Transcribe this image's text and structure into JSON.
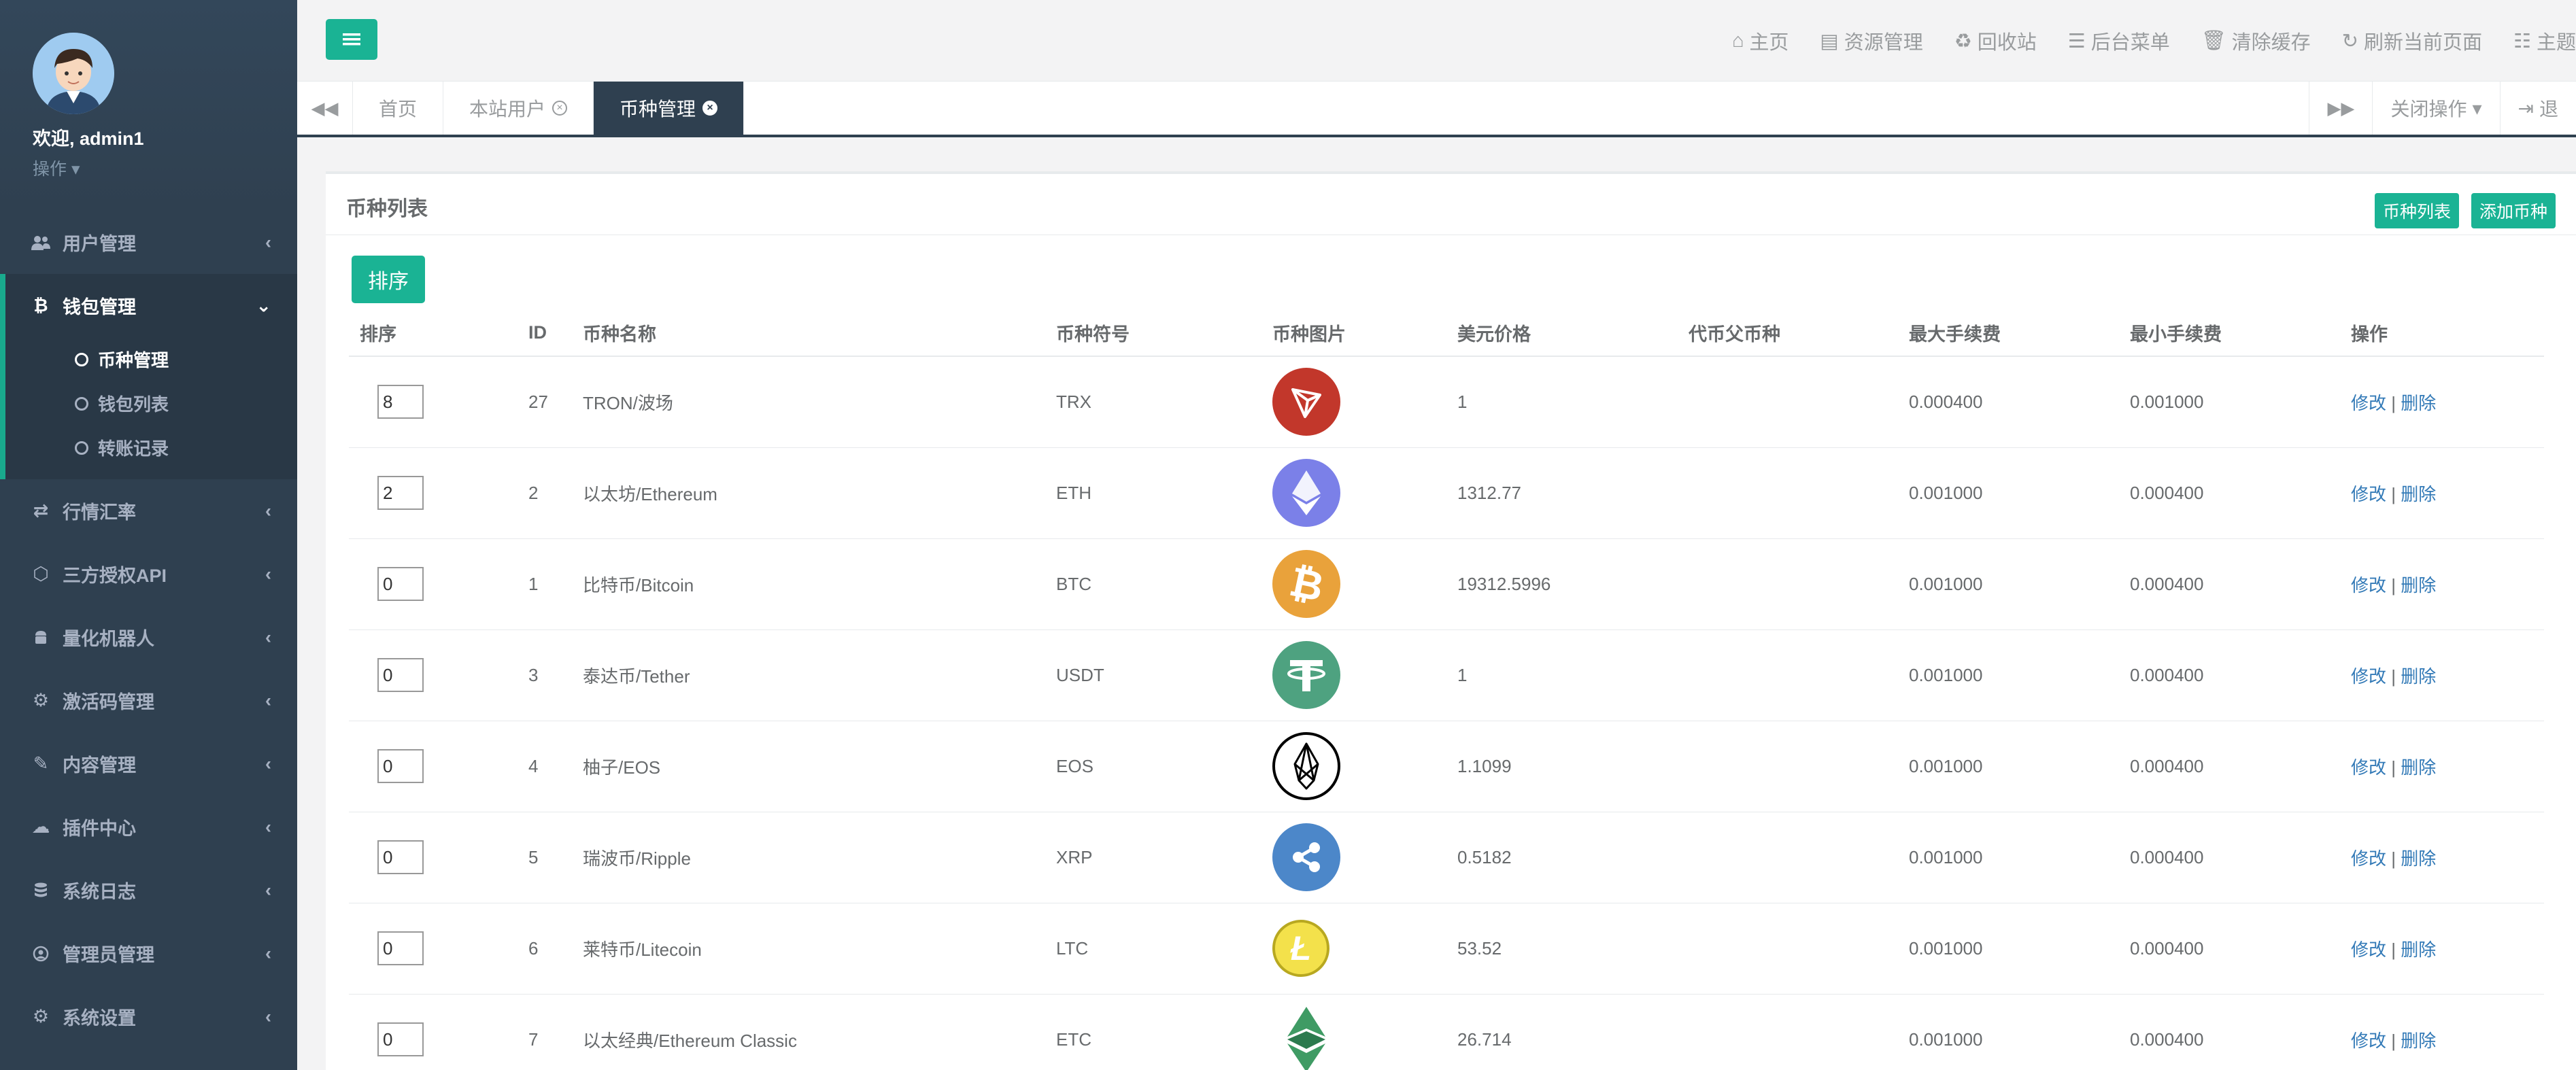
{
  "profile": {
    "welcome": "欢迎, admin1",
    "op_label": "操作"
  },
  "sidebar": {
    "items": [
      {
        "label": "用户管理",
        "icon": "users-icon"
      },
      {
        "label": "钱包管理",
        "icon": "bitcoin-icon",
        "expanded": true,
        "children": [
          {
            "label": "币种管理",
            "current": true
          },
          {
            "label": "钱包列表"
          },
          {
            "label": "转账记录"
          }
        ]
      },
      {
        "label": "行情汇率",
        "icon": "exchange-icon"
      },
      {
        "label": "三方授权API",
        "icon": "cube-icon"
      },
      {
        "label": "量化机器人",
        "icon": "android-icon"
      },
      {
        "label": "激活码管理",
        "icon": "gear-icon"
      },
      {
        "label": "内容管理",
        "icon": "edit-icon"
      },
      {
        "label": "插件中心",
        "icon": "cloud-icon"
      },
      {
        "label": "系统日志",
        "icon": "database-icon"
      },
      {
        "label": "管理员管理",
        "icon": "user-circle-icon"
      },
      {
        "label": "系统设置",
        "icon": "cogs-icon"
      }
    ]
  },
  "toplinks": [
    {
      "label": "主页",
      "icon": "home-icon"
    },
    {
      "label": "资源管理",
      "icon": "file-icon"
    },
    {
      "label": "回收站",
      "icon": "recycle-icon"
    },
    {
      "label": "后台菜单",
      "icon": "list-icon"
    },
    {
      "label": "清除缓存",
      "icon": "trash-icon"
    },
    {
      "label": "刷新当前页面",
      "icon": "refresh-icon"
    },
    {
      "label": "主题",
      "icon": "theme-icon"
    }
  ],
  "tabs": [
    {
      "label": "首页",
      "closable": false
    },
    {
      "label": "本站用户",
      "closable": true
    },
    {
      "label": "币种管理",
      "closable": true,
      "active": true
    }
  ],
  "tab_actions": {
    "close_ops": "关闭操作",
    "exit": "退"
  },
  "panel": {
    "title": "币种列表",
    "btn_list": "币种列表",
    "btn_add": "添加币种",
    "sort_btn": "排序"
  },
  "table": {
    "headers": [
      "排序",
      "ID",
      "币种名称",
      "币种符号",
      "币种图片",
      "美元价格",
      "代币父币种",
      "最大手续费",
      "最小手续费",
      "操作"
    ],
    "rows": [
      {
        "sort": "8",
        "id": "27",
        "name": "TRON/波场",
        "symbol": "TRX",
        "logo": "tron-logo-icon",
        "price": "1",
        "parent": "",
        "max_fee": "0.000400",
        "min_fee": "0.001000"
      },
      {
        "sort": "2",
        "id": "2",
        "name": "以太坊/Ethereum",
        "symbol": "ETH",
        "logo": "ethereum-logo-icon",
        "price": "1312.77",
        "parent": "",
        "max_fee": "0.001000",
        "min_fee": "0.000400"
      },
      {
        "sort": "0",
        "id": "1",
        "name": "比特币/Bitcoin",
        "symbol": "BTC",
        "logo": "bitcoin-logo-icon",
        "price": "19312.5996",
        "parent": "",
        "max_fee": "0.001000",
        "min_fee": "0.000400"
      },
      {
        "sort": "0",
        "id": "3",
        "name": "泰达币/Tether",
        "symbol": "USDT",
        "logo": "tether-logo-icon",
        "price": "1",
        "parent": "",
        "max_fee": "0.001000",
        "min_fee": "0.000400"
      },
      {
        "sort": "0",
        "id": "4",
        "name": "柚子/EOS",
        "symbol": "EOS",
        "logo": "eos-logo-icon",
        "price": "1.1099",
        "parent": "",
        "max_fee": "0.001000",
        "min_fee": "0.000400"
      },
      {
        "sort": "0",
        "id": "5",
        "name": "瑞波币/Ripple",
        "symbol": "XRP",
        "logo": "ripple-logo-icon",
        "price": "0.5182",
        "parent": "",
        "max_fee": "0.001000",
        "min_fee": "0.000400"
      },
      {
        "sort": "0",
        "id": "6",
        "name": "莱特币/Litecoin",
        "symbol": "LTC",
        "logo": "litecoin-logo-icon",
        "price": "53.52",
        "parent": "",
        "max_fee": "0.001000",
        "min_fee": "0.000400"
      },
      {
        "sort": "0",
        "id": "7",
        "name": "以太经典/Ethereum Classic",
        "symbol": "ETC",
        "logo": "ethereum-classic-logo-icon",
        "price": "26.714",
        "parent": "",
        "max_fee": "0.001000",
        "min_fee": "0.000400"
      }
    ],
    "edit_label": "修改",
    "sep": "|",
    "delete_label": "删除"
  },
  "colors": {
    "sidebar_bg": "#2f4050",
    "accent": "#1ab394",
    "link": "#337ab7"
  }
}
